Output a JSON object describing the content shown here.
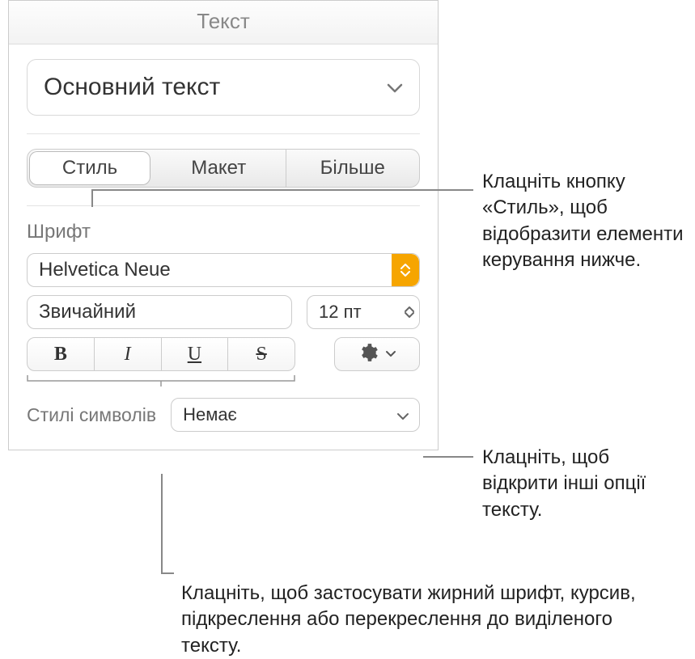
{
  "header": {
    "title": "Текст"
  },
  "paragraph_style": {
    "selected": "Основний текст"
  },
  "tabs": {
    "style": "Стиль",
    "layout": "Макет",
    "more": "Більше"
  },
  "font_section": {
    "label": "Шрифт",
    "family": "Helvetica Neue",
    "weight": "Звичайний",
    "size": "12 пт"
  },
  "format_buttons": {
    "b": "B",
    "i": "I",
    "u": "U",
    "s": "S"
  },
  "char_styles": {
    "label": "Стилі символів",
    "value": "Немає"
  },
  "callouts": {
    "style_tab": "Клацніть кнопку «Стиль», щоб відобразити елементи керування нижче.",
    "gear": "Клацніть, щоб відкрити інші опції тексту.",
    "bius": "Клацніть, щоб застосувати жирний шрифт, курсив, підкреслення або перекреслення до виділеного тексту."
  }
}
